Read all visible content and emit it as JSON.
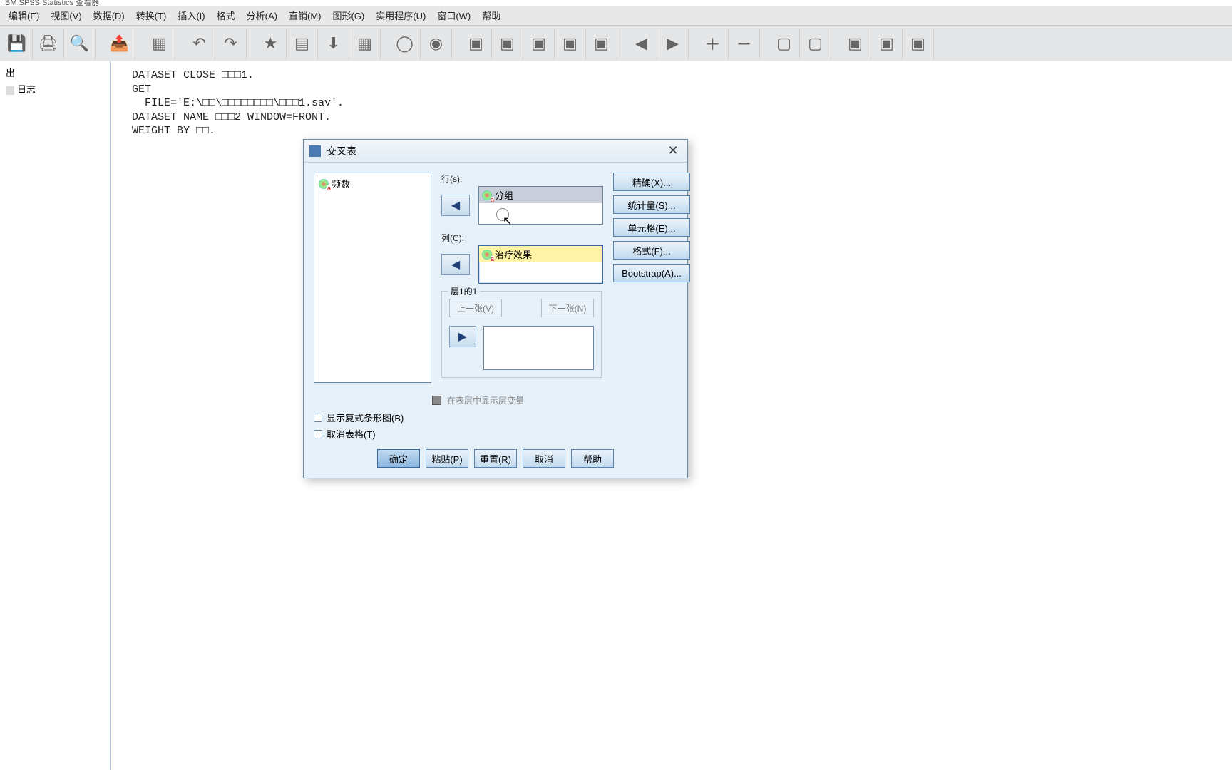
{
  "title_bar": "IBM SPSS Statistics 查看器",
  "menus": {
    "edit": "编辑(E)",
    "view": "视图(V)",
    "data": "数据(D)",
    "transform": "转换(T)",
    "insert": "插入(I)",
    "format": "格式",
    "analyze": "分析(A)",
    "direct": "直销(M)",
    "graph": "图形(G)",
    "util": "实用程序(U)",
    "window": "窗口(W)",
    "help": "帮助"
  },
  "sidebar": {
    "node_out": "出",
    "node_log": "日志"
  },
  "syntax": "DATASET CLOSE □□□1.\nGET\n  FILE='E:\\□□\\□□□□□□□□\\□□□1.sav'.\nDATASET NAME □□□2 WINDOW=FRONT.\nWEIGHT BY □□.",
  "dialog": {
    "title": "交叉表",
    "source_vars": [
      "频数"
    ],
    "rows_label": "行(s):",
    "rows_items": [
      "分组"
    ],
    "cols_label": "列(C):",
    "cols_items": [
      "治疗效果"
    ],
    "layer": {
      "title": "层1的1",
      "prev": "上一张(V)",
      "next": "下一张(N)"
    },
    "layer_check": "在表层中显示层变量",
    "chk_bar": "显示复式条形图(B)",
    "chk_suppress": "取消表格(T)",
    "right_buttons": {
      "exact": "精确(X)...",
      "stats": "统计量(S)...",
      "cells": "单元格(E)...",
      "format": "格式(F)...",
      "bootstrap": "Bootstrap(A)..."
    },
    "buttons": {
      "ok": "确定",
      "paste": "粘贴(P)",
      "reset": "重置(R)",
      "cancel": "取消",
      "help": "帮助"
    }
  }
}
